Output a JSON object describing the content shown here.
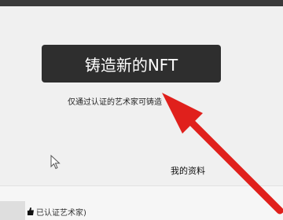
{
  "mint_button_label": "铸造新的NFT",
  "caption": "仅通过认证的艺术家可铸造",
  "profile_link": "我的资料",
  "verified_status": "已认证艺术家)",
  "colors": {
    "button_bg": "#2e2e2e",
    "arrow": "#e0201c",
    "page_bg": "#f0f0f0"
  },
  "icons": [
    "mouse-cursor-icon",
    "verified-badge-icon",
    "red-arrow-annotation"
  ]
}
